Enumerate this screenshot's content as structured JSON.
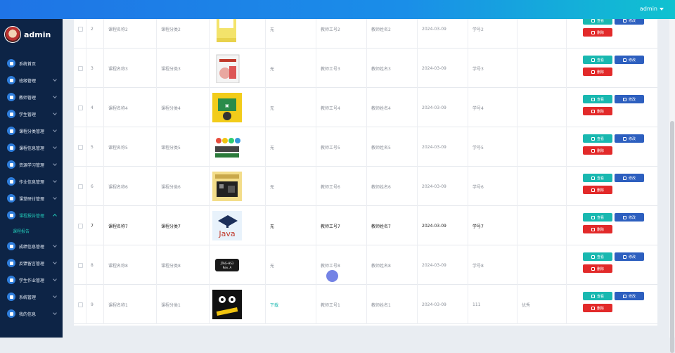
{
  "header": {
    "user": "admin"
  },
  "sidebar": {
    "brand": "admin",
    "items": [
      {
        "label": "系统首页",
        "icon": "home-icon"
      },
      {
        "label": "班级管理",
        "icon": "class-icon"
      },
      {
        "label": "教师管理",
        "icon": "teacher-icon"
      },
      {
        "label": "学生管理",
        "icon": "student-icon"
      },
      {
        "label": "课程分类管理",
        "icon": "category-icon"
      },
      {
        "label": "课程信息管理",
        "icon": "course-icon"
      },
      {
        "label": "资源学习管理",
        "icon": "resource-icon"
      },
      {
        "label": "作业信息管理",
        "icon": "homework-icon"
      },
      {
        "label": "课堂研讨管理",
        "icon": "discussion-icon"
      },
      {
        "label": "课程报告管理",
        "icon": "report-icon"
      },
      {
        "label": "成绩信息管理",
        "icon": "grade-icon"
      },
      {
        "label": "反馈留言管理",
        "icon": "feedback-icon"
      },
      {
        "label": "学生作业管理",
        "icon": "assignment-icon"
      },
      {
        "label": "系统管理",
        "icon": "system-icon"
      },
      {
        "label": "我的信息",
        "icon": "profile-icon"
      }
    ],
    "active_sub": "课程报告"
  },
  "actions": {
    "view": "查看",
    "edit": "修改",
    "delete": "删除"
  },
  "rows": [
    {
      "num": "2",
      "name": "课程名称2",
      "cat": "课程分类2",
      "flag": "无",
      "tno": "教师工号2",
      "tname": "教师姓名2",
      "date": "2024-03-09",
      "sno": "学号2",
      "extra": "",
      "img": "python",
      "bold": false
    },
    {
      "num": "3",
      "name": "课程名称3",
      "cat": "课程分类3",
      "flag": "无",
      "tno": "教师工号3",
      "tname": "教师姓名3",
      "date": "2024-03-09",
      "sno": "学号3",
      "extra": "",
      "img": "book",
      "bold": false
    },
    {
      "num": "4",
      "name": "课程名称4",
      "cat": "课程分类4",
      "flag": "无",
      "tno": "教师工号4",
      "tname": "教师姓名4",
      "date": "2024-03-09",
      "sno": "学号4",
      "extra": "",
      "img": "robot",
      "bold": false
    },
    {
      "num": "5",
      "name": "课程名称5",
      "cat": "课程分类5",
      "flag": "无",
      "tno": "教师工号5",
      "tname": "教师姓名5",
      "date": "2024-03-09",
      "sno": "学号5",
      "extra": "",
      "img": "blocks",
      "bold": false
    },
    {
      "num": "6",
      "name": "课程名称6",
      "cat": "课程分类6",
      "flag": "无",
      "tno": "教师工号6",
      "tname": "教师姓名6",
      "date": "2024-03-09",
      "sno": "学号6",
      "extra": "",
      "img": "board",
      "bold": false
    },
    {
      "num": "7",
      "name": "课程名称7",
      "cat": "课程分类7",
      "flag": "无",
      "tno": "教师工号7",
      "tname": "教师姓名7",
      "date": "2024-03-09",
      "sno": "学号7",
      "extra": "",
      "img": "java",
      "bold": true
    },
    {
      "num": "8",
      "name": "课程名称8",
      "cat": "课程分类8",
      "flag": "无",
      "tno": "教师工号8",
      "tname": "教师姓名8",
      "date": "2024-03-09",
      "sno": "学号8",
      "extra": "",
      "img": "jtag",
      "bold": false
    },
    {
      "num": "9",
      "name": "课程名称1",
      "cat": "课程分类1",
      "flag": "下载",
      "tno": "教师工号1",
      "tname": "教师姓名1",
      "date": "2024-03-09",
      "sno": "111",
      "extra": "优秀",
      "img": "cat",
      "bold": false
    }
  ],
  "thumb_labels": {
    "jtag": "JTAG-HS3 Rev. A",
    "java": "Java"
  }
}
